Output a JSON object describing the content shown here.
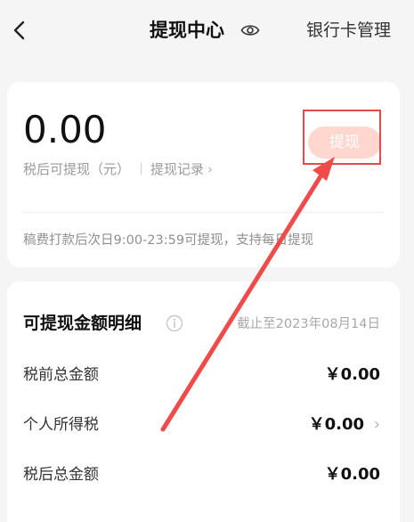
{
  "nav": {
    "title": "提现中心",
    "right_link": "银行卡管理",
    "icons": [
      "back-arrow-icon",
      "eye-icon"
    ]
  },
  "balance": {
    "amount": "0.00",
    "label": "税后可提现（元）",
    "records_link": "提现记录",
    "withdraw_button": "提现",
    "note": "稿费打款后次日9:00-23:59可提现，支持每日提现"
  },
  "details": {
    "title": "可提现金额明细",
    "date_note": "截止至2023年08月14日",
    "rows": [
      {
        "label": "税前总金额",
        "value": "￥0.00"
      },
      {
        "label": "个人所得税",
        "value": "￥0.00"
      },
      {
        "label": "税后总金额",
        "value": "￥0.00"
      }
    ]
  },
  "colors": {
    "accent_highlight": "#e04c4c",
    "button_disabled": "#ffd7cf",
    "background": "#f5f5f6"
  }
}
